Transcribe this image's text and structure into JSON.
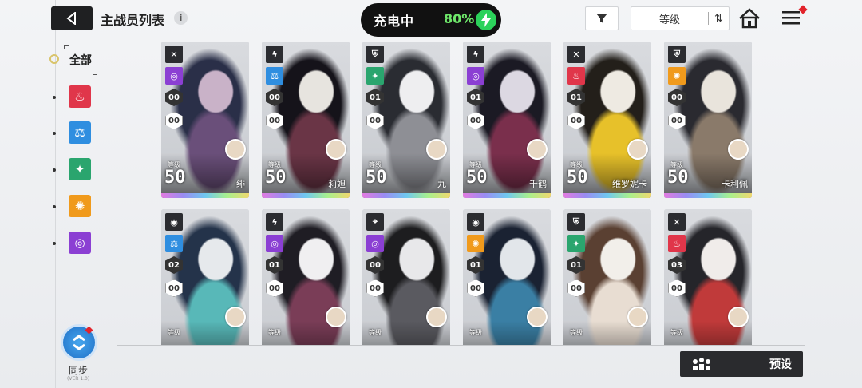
{
  "header": {
    "title": "主战员列表",
    "info_icon": "i",
    "back_icon": "back-arrow-icon"
  },
  "charging": {
    "label": "充电中",
    "percent": "80%",
    "icon": "lightning-icon"
  },
  "toolbar": {
    "filter_icon": "filter-icon",
    "sort_label": "等级",
    "sort_toggle_icon": "sort-order-icon",
    "home_icon": "home-icon",
    "menu_icon": "menu-icon"
  },
  "sidebar": {
    "all_label": "全部",
    "categories": [
      {
        "name": "fire",
        "color": "#e0364a",
        "glyph": "♨"
      },
      {
        "name": "balance",
        "color": "#2f8ee0",
        "glyph": "⚖"
      },
      {
        "name": "wind",
        "color": "#2aa56e",
        "glyph": "✦"
      },
      {
        "name": "sun",
        "color": "#f09a1c",
        "glyph": "✺"
      },
      {
        "name": "void",
        "color": "#8b3fd3",
        "glyph": "◎"
      }
    ],
    "sync_label": "同步",
    "sync_sub": "(VER 1.0)"
  },
  "cards": [
    {
      "name": "绯",
      "class_icon": "swords-icon",
      "elem_color": "#8b3fd3",
      "elem_glyph": "◎",
      "stars": "00",
      "mods": "00",
      "lvl_label": "等级",
      "level": "50",
      "palette": [
        "#2a2f48",
        "#6a4f7a",
        "#c9b2c8"
      ]
    },
    {
      "name": "莉妲",
      "class_icon": "bolt-icon",
      "elem_color": "#2f8ee0",
      "elem_glyph": "⚖",
      "stars": "00",
      "mods": "00",
      "lvl_label": "等级",
      "level": "50",
      "palette": [
        "#15131a",
        "#6a3546",
        "#e7e4df"
      ]
    },
    {
      "name": "九",
      "class_icon": "shield-icon",
      "elem_color": "#2aa56e",
      "elem_glyph": "✦",
      "stars": "01",
      "mods": "00",
      "lvl_label": "等级",
      "level": "50",
      "palette": [
        "#2a2c32",
        "#8e8f95",
        "#eeeef0"
      ]
    },
    {
      "name": "千鹤",
      "class_icon": "bolt-icon",
      "elem_color": "#8b3fd3",
      "elem_glyph": "◎",
      "stars": "01",
      "mods": "00",
      "lvl_label": "等级",
      "level": "50",
      "palette": [
        "#1b1a24",
        "#7a2f4c",
        "#dcd8e2"
      ]
    },
    {
      "name": "维罗妮卡",
      "class_icon": "swords-icon",
      "elem_color": "#e0364a",
      "elem_glyph": "♨",
      "stars": "01",
      "mods": "00",
      "lvl_label": "等级",
      "level": "50",
      "palette": [
        "#231f1a",
        "#e7c12a",
        "#eeeae2"
      ]
    },
    {
      "name": "卡利佩",
      "class_icon": "shield-icon",
      "elem_color": "#f09a1c",
      "elem_glyph": "✺",
      "stars": "00",
      "mods": "00",
      "lvl_label": "等级",
      "level": "50",
      "palette": [
        "#2a2a30",
        "#8a7a6a",
        "#e9e4dc"
      ]
    },
    {
      "name": "",
      "class_icon": "target-icon",
      "elem_color": "#2f8ee0",
      "elem_glyph": "⚖",
      "stars": "02",
      "mods": "00",
      "lvl_label": "等级",
      "level": "",
      "palette": [
        "#24334a",
        "#58b8b8",
        "#e6e9ec"
      ]
    },
    {
      "name": "",
      "class_icon": "bolt-icon",
      "elem_color": "#8b3fd3",
      "elem_glyph": "◎",
      "stars": "01",
      "mods": "00",
      "lvl_label": "等级",
      "level": "",
      "palette": [
        "#1f1d24",
        "#7a3d57",
        "#f0eff1"
      ]
    },
    {
      "name": "",
      "class_icon": "crosshair-icon",
      "elem_color": "#8b3fd3",
      "elem_glyph": "◎",
      "stars": "00",
      "mods": "00",
      "lvl_label": "等级",
      "level": "",
      "palette": [
        "#1d1d1f",
        "#5a5a60",
        "#e8e8ea"
      ]
    },
    {
      "name": "",
      "class_icon": "target-icon",
      "elem_color": "#f09a1c",
      "elem_glyph": "✺",
      "stars": "01",
      "mods": "00",
      "lvl_label": "等级",
      "level": "",
      "palette": [
        "#1a2232",
        "#3a7fa4",
        "#e2e6ea"
      ]
    },
    {
      "name": "",
      "class_icon": "shield-icon",
      "elem_color": "#2aa56e",
      "elem_glyph": "✦",
      "stars": "01",
      "mods": "00",
      "lvl_label": "等级",
      "level": "",
      "palette": [
        "#5a4032",
        "#e8ddd2",
        "#f2efea"
      ]
    },
    {
      "name": "",
      "class_icon": "swords-icon",
      "elem_color": "#e0364a",
      "elem_glyph": "♨",
      "stars": "03",
      "mods": "00",
      "lvl_label": "等级",
      "level": "",
      "palette": [
        "#25252a",
        "#c03a3a",
        "#f0ecea"
      ]
    }
  ],
  "preset": {
    "label": "预设",
    "icon": "team-preset-icon"
  }
}
